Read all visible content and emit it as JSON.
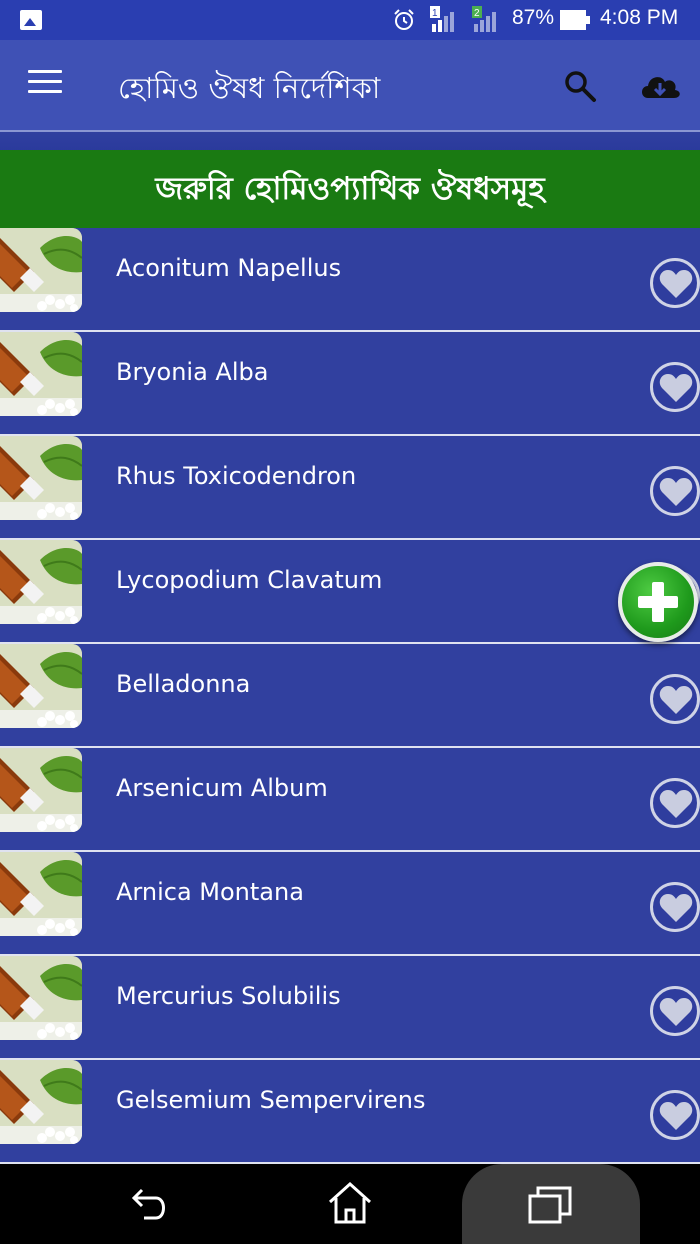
{
  "status_bar": {
    "signal_sim1": "1",
    "signal_sim2": "2",
    "battery": "87%",
    "time": "4:08 PM",
    "icons": [
      "image-icon",
      "alarm-icon",
      "signal-sim1-icon",
      "signal-sim2-icon",
      "battery-icon"
    ]
  },
  "toolbar": {
    "title": "হোমিও ঔষধ নির্দেশিকা",
    "icons": [
      "menu-icon",
      "search-icon",
      "cloud-download-icon"
    ]
  },
  "section": {
    "title": "জরুরি হোমিওপ্যাথিক ঔষধসমূহ"
  },
  "medicines": [
    {
      "name": "Aconitum Napellus"
    },
    {
      "name": "Bryonia Alba"
    },
    {
      "name": "Rhus Toxicodendron"
    },
    {
      "name": "Lycopodium Clavatum"
    },
    {
      "name": "Belladonna"
    },
    {
      "name": "Arsenicum Album"
    },
    {
      "name": "Arnica Montana"
    },
    {
      "name": "Mercurius Solubilis"
    },
    {
      "name": "Gelsemium Sempervirens"
    }
  ],
  "colors": {
    "toolbar": "#3f51b5",
    "list_background": "#31409f",
    "section_header": "#1a7a12",
    "fab": "#1f9a1c"
  },
  "nav_bar": {
    "icons": [
      "back-icon",
      "home-icon",
      "recents-icon"
    ]
  }
}
